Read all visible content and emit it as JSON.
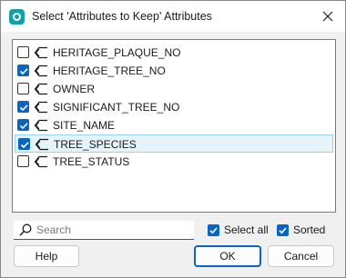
{
  "window": {
    "title": "Select 'Attributes to Keep' Attributes",
    "accent_color": "#0a64c2",
    "app_icon": "app-logo-icon",
    "close_icon": "close-icon"
  },
  "attributes": [
    {
      "label": "HERITAGE_PLAQUE_NO",
      "checked": false,
      "selected": false
    },
    {
      "label": "HERITAGE_TREE_NO",
      "checked": true,
      "selected": false
    },
    {
      "label": "OWNER",
      "checked": false,
      "selected": false
    },
    {
      "label": "SIGNIFICANT_TREE_NO",
      "checked": true,
      "selected": false
    },
    {
      "label": "SITE_NAME",
      "checked": true,
      "selected": false
    },
    {
      "label": "TREE_SPECIES",
      "checked": true,
      "selected": true
    },
    {
      "label": "TREE_STATUS",
      "checked": false,
      "selected": false
    }
  ],
  "search": {
    "placeholder": "Search",
    "value": ""
  },
  "options": {
    "select_all_label": "Select all",
    "select_all_checked": true,
    "sorted_label": "Sorted",
    "sorted_checked": true
  },
  "buttons": {
    "help": "Help",
    "ok": "OK",
    "cancel": "Cancel"
  }
}
